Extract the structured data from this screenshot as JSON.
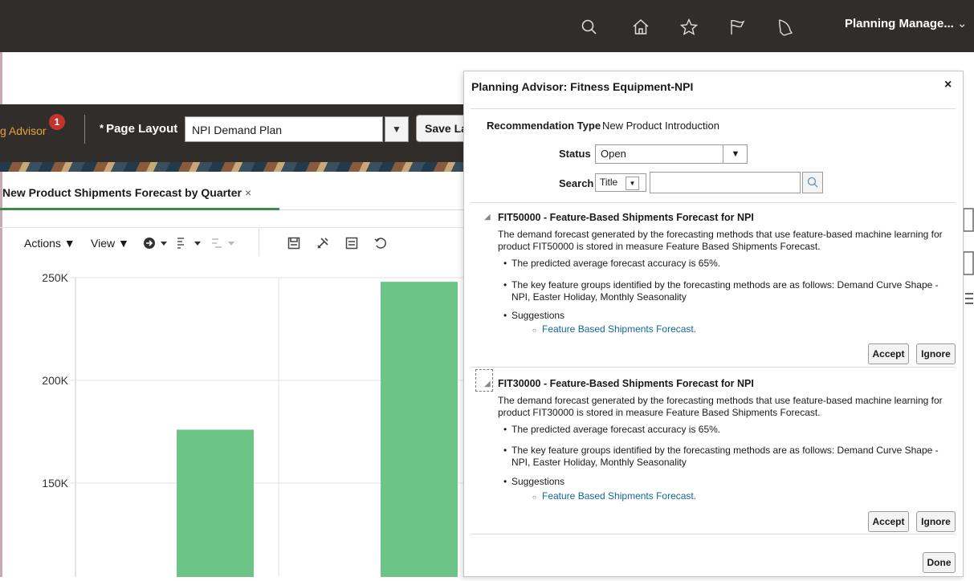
{
  "header": {
    "user_menu": "Planning Manage...",
    "icons": [
      "search-icon",
      "home-icon",
      "favorites-icon",
      "flag-icon",
      "notifications-icon"
    ]
  },
  "toolbar": {
    "advisor_label": "g Advisor",
    "advisor_badge": "1",
    "page_layout_label": "Page Layout",
    "required_marker": "*",
    "page_layout_value": "NPI Demand Plan",
    "save_label": "Save La"
  },
  "tab": {
    "label": "New Product Shipments Forecast by Quarter",
    "close": "×"
  },
  "chart_toolbar": {
    "actions": "Actions",
    "view": "View"
  },
  "chart_data": {
    "type": "bar",
    "title": "",
    "xlabel": "",
    "ylabel": "",
    "yticks": [
      "250K",
      "200K",
      "150K"
    ],
    "ylim": [
      100000,
      250000
    ],
    "visible_ylim": [
      110000,
      250000
    ],
    "values": [
      176000,
      248000
    ],
    "bar_color": "#6cc486",
    "grid": true
  },
  "advisor": {
    "title": "Planning Advisor: Fitness Equipment-NPI",
    "close": "×",
    "rec_type_label": "Recommendation Type",
    "rec_type_value": "New Product Introduction",
    "status_label": "Status",
    "status_value": "Open",
    "search_label": "Search",
    "search_field": "Title",
    "search_value": "",
    "recommendations": [
      {
        "title": "FIT50000 - Feature-Based Shipments Forecast for NPI",
        "description": "The demand forecast generated by the forecasting methods that use feature-based machine learning for product FIT50000 is stored in measure Feature Based Shipments Forecast.",
        "bullet1": "The predicted average forecast accuracy is 65%.",
        "bullet2": "The key feature groups identified by the forecasting methods are as follows: Demand Curve Shape - NPI, Easter Holiday, Monthly Seasonality",
        "bullet3": "Suggestions",
        "suggestion": "Feature Based Shipments Forecast.",
        "accept": "Accept",
        "ignore": "Ignore"
      },
      {
        "title": "FIT30000 - Feature-Based Shipments Forecast for NPI",
        "description": "The demand forecast generated by the forecasting methods that use feature-based machine learning for product FIT30000 is stored in measure Feature Based Shipments Forecast.",
        "bullet1": "The predicted average forecast accuracy is 65%.",
        "bullet2": "The key feature groups identified by the forecasting methods are as follows: Demand Curve Shape - NPI, Easter Holiday, Monthly Seasonality",
        "bullet3": "Suggestions",
        "suggestion": "Feature Based Shipments Forecast.",
        "accept": "Accept",
        "ignore": "Ignore"
      }
    ],
    "done": "Done"
  }
}
